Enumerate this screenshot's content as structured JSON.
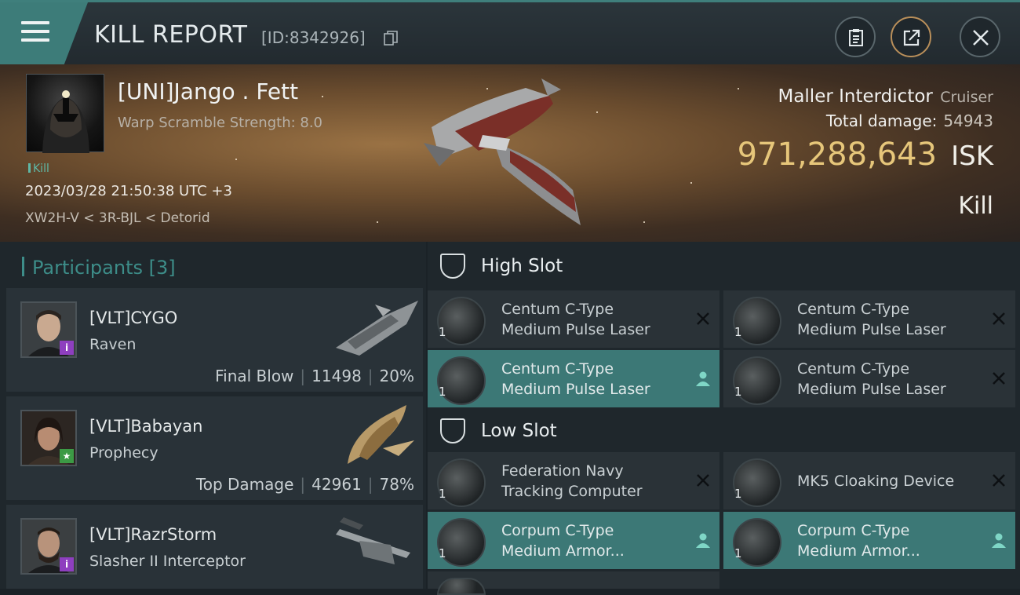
{
  "header": {
    "title": "KILL REPORT",
    "report_id": "[ID:8342926]"
  },
  "victim": {
    "name": "[UNI]Jango . Fett",
    "warp_scramble": "Warp Scramble Strength: 8.0",
    "kill_tag": "Kill",
    "datetime": "2023/03/28 21:50:38 UTC +3",
    "location": "XW2H-V < 3R-BJL < Detorid",
    "ship_name": "Maller Interdictor",
    "ship_class": "Cruiser",
    "total_damage_label": "Total damage:",
    "total_damage": "54943",
    "isk_value": "971,288,643",
    "isk_unit": "ISK",
    "result": "Kill"
  },
  "participants": {
    "title": "Participants",
    "count": "[3]",
    "items": [
      {
        "name": "[VLT]CYGO",
        "ship": "Raven",
        "role": "Final Blow",
        "damage": "11498",
        "percent": "20%",
        "badge": "i",
        "badge_color": "#8e3fbf"
      },
      {
        "name": "[VLT]Babayan",
        "ship": "Prophecy",
        "role": "Top Damage",
        "damage": "42961",
        "percent": "78%",
        "badge": "★",
        "badge_color": "#3c9a45"
      },
      {
        "name": "[VLT]RazrStorm",
        "ship": "Slasher II Interceptor",
        "role": "",
        "damage": "",
        "percent": "",
        "badge": "i",
        "badge_color": "#8e3fbf"
      }
    ]
  },
  "slots": {
    "high_label": "High Slot",
    "low_label": "Low Slot",
    "high": [
      {
        "qty": "1",
        "line1": "Centum C-Type",
        "line2": "Medium Pulse Laser",
        "status": "destroyed"
      },
      {
        "qty": "1",
        "line1": "Centum C-Type",
        "line2": "Medium Pulse Laser",
        "status": "destroyed"
      },
      {
        "qty": "1",
        "line1": "Centum C-Type",
        "line2": "Medium Pulse Laser",
        "status": "dropped"
      },
      {
        "qty": "1",
        "line1": "Centum C-Type",
        "line2": "Medium Pulse Laser",
        "status": "destroyed"
      }
    ],
    "low": [
      {
        "qty": "1",
        "line1": "Federation Navy",
        "line2": "Tracking Computer",
        "status": "destroyed"
      },
      {
        "qty": "1",
        "line1": "MK5 Cloaking Device",
        "line2": "",
        "status": "destroyed"
      },
      {
        "qty": "1",
        "line1": "Corpum C-Type",
        "line2": "Medium Armor...",
        "status": "dropped"
      },
      {
        "qty": "1",
        "line1": "Corpum C-Type",
        "line2": "Medium Armor...",
        "status": "dropped"
      }
    ]
  },
  "colors": {
    "accent": "#3d8d89",
    "isk": "#e6c67a",
    "dropped_bg": "#3c7876"
  }
}
